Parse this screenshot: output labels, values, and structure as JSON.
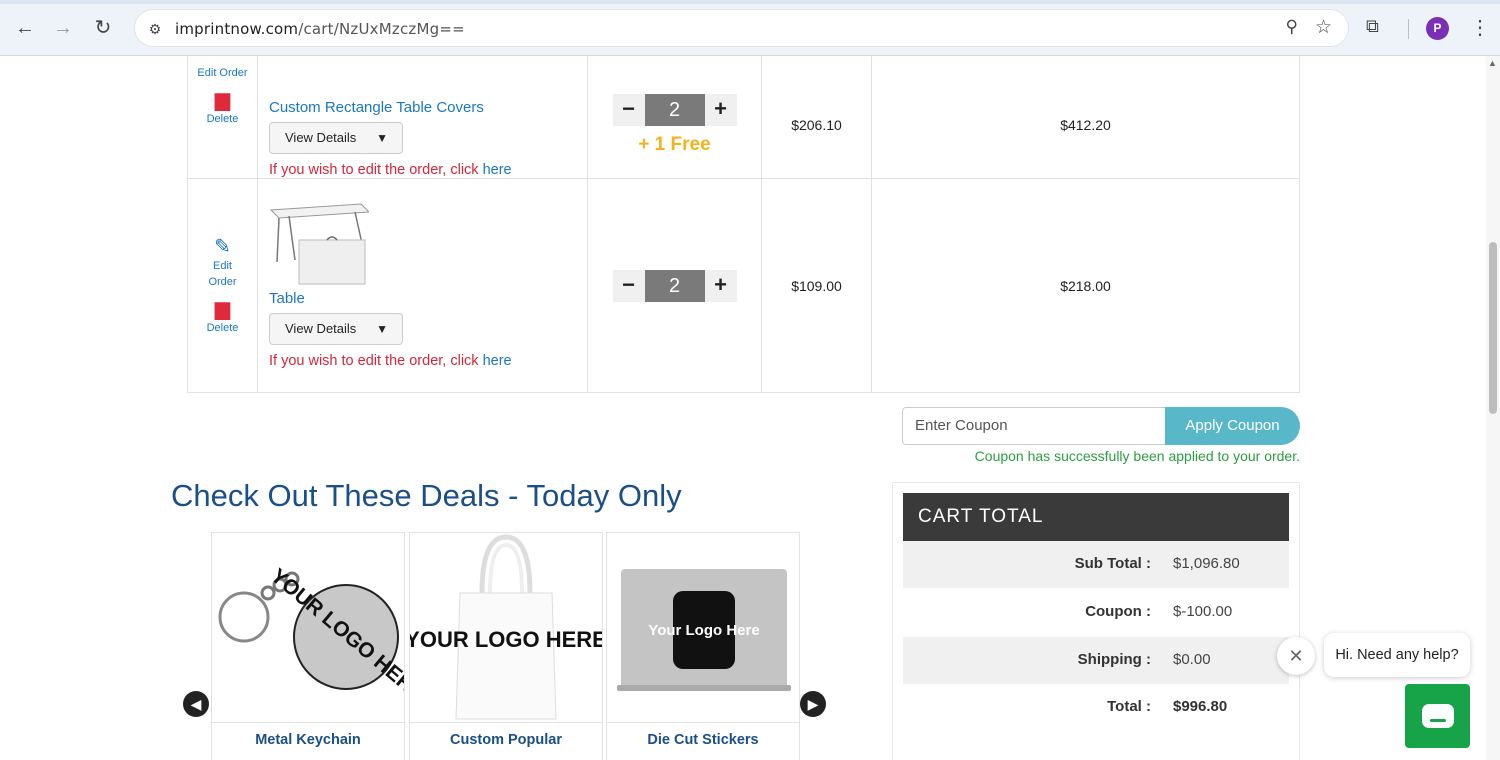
{
  "browser": {
    "url_host": "imprintnow.com",
    "url_path": "/cart/NzUxMzczMg=="
  },
  "cart": {
    "rows": [
      {
        "edit_label": "Edit Order",
        "delete_label": "Delete",
        "product_name": "Custom Rectangle Table Covers",
        "view_details_label": "View Details",
        "edit_note": "If you wish to edit the order, click",
        "edit_link": "here",
        "quantity": "2",
        "free_label": "+ 1 Free",
        "price": "$206.10",
        "total": "$412.20"
      },
      {
        "edit_label_1": "Edit",
        "edit_label_2": "Order",
        "delete_label": "Delete",
        "product_name": "Table",
        "view_details_label": "View Details",
        "edit_note": "If you wish to edit the order, click",
        "edit_link": "here",
        "quantity": "2",
        "price": "$109.00",
        "total": "$218.00"
      }
    ]
  },
  "coupon": {
    "placeholder": "Enter Coupon",
    "button_label": "Apply Coupon",
    "success_message": "Coupon has successfully been applied to your order."
  },
  "deals": {
    "title": "Check Out These Deals - Today Only",
    "items": [
      {
        "name": "Metal Keychain",
        "logo_text": "YOUR LOGO HERE"
      },
      {
        "name": "Custom Popular",
        "logo_text": "YOUR LOGO HERE"
      },
      {
        "name": "Die Cut Stickers",
        "logo_text": "Your Logo Here"
      }
    ]
  },
  "cart_total": {
    "header": "CART TOTAL",
    "rows": [
      {
        "label": "Sub Total :",
        "value": "$1,096.80"
      },
      {
        "label": "Coupon :",
        "value": "$-100.00"
      },
      {
        "label": "Shipping :",
        "value": "$0.00"
      },
      {
        "label": "Total :",
        "value": "$996.80"
      }
    ]
  },
  "chat": {
    "greeting": "Hi. Need any help?"
  },
  "profile_initial": "P"
}
